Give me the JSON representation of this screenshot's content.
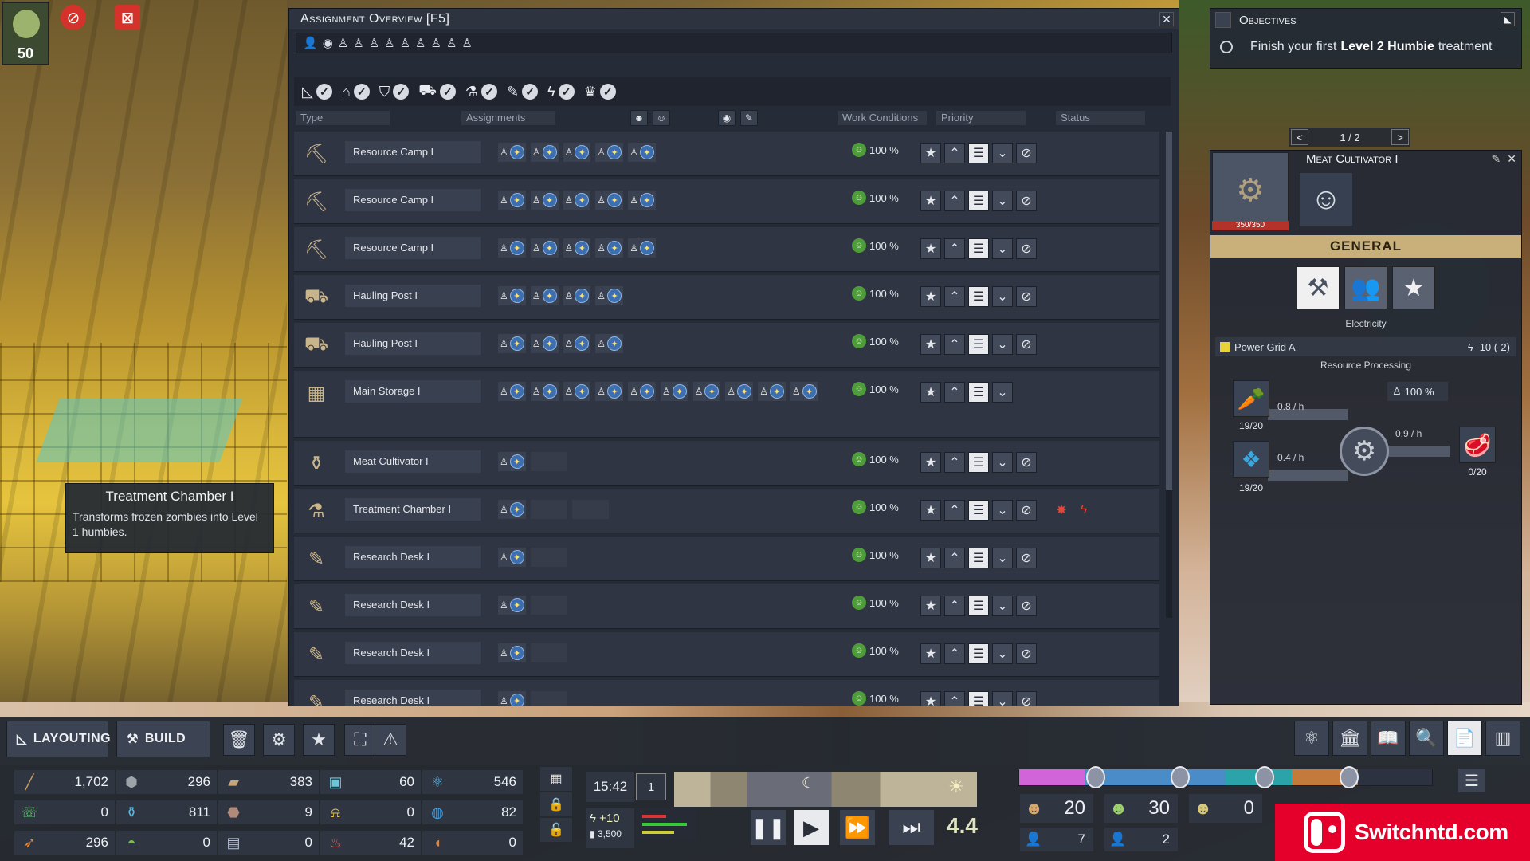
{
  "hud": {
    "population": "50"
  },
  "assignment_overview": {
    "title": "Assignment Overview [F5]",
    "close_label": "✕",
    "headers": {
      "type": "Type",
      "assignments": "Assignments",
      "work_conditions": "Work Conditions",
      "priority": "Priority",
      "status": "Status"
    },
    "rows": [
      {
        "name": "Resource Camp I",
        "icon": "resource-camp-icon",
        "slots": 5,
        "empty": 0,
        "wc": "100 %",
        "cancel": true,
        "status": []
      },
      {
        "name": "Resource Camp I",
        "icon": "resource-camp-icon",
        "slots": 5,
        "empty": 0,
        "wc": "100 %",
        "cancel": true,
        "status": []
      },
      {
        "name": "Resource Camp I",
        "icon": "resource-camp-icon",
        "slots": 5,
        "empty": 0,
        "wc": "100 %",
        "cancel": true,
        "status": []
      },
      {
        "name": "Hauling Post I",
        "icon": "hauling-post-icon",
        "slots": 4,
        "empty": 0,
        "wc": "100 %",
        "cancel": true,
        "status": []
      },
      {
        "name": "Hauling Post I",
        "icon": "hauling-post-icon",
        "slots": 4,
        "empty": 0,
        "wc": "100 %",
        "cancel": true,
        "status": []
      },
      {
        "name": "Main Storage I",
        "icon": "main-storage-icon",
        "slots": 10,
        "empty": 0,
        "wc": "100 %",
        "cancel": false,
        "status": [],
        "tall": true
      },
      {
        "name": "Meat Cultivator I",
        "icon": "meat-cultivator-icon",
        "slots": 1,
        "empty": 1,
        "wc": "100 %",
        "cancel": true,
        "status": []
      },
      {
        "name": "Treatment Chamber I",
        "icon": "treatment-chamber-icon",
        "slots": 1,
        "empty": 2,
        "wc": "100 %",
        "cancel": true,
        "status": [
          "no-resource-icon",
          "no-power-icon"
        ]
      },
      {
        "name": "Research Desk I",
        "icon": "research-desk-icon",
        "slots": 1,
        "empty": 1,
        "wc": "100 %",
        "cancel": true,
        "status": []
      },
      {
        "name": "Research Desk I",
        "icon": "research-desk-icon",
        "slots": 1,
        "empty": 1,
        "wc": "100 %",
        "cancel": true,
        "status": []
      },
      {
        "name": "Research Desk I",
        "icon": "research-desk-icon",
        "slots": 1,
        "empty": 1,
        "wc": "100 %",
        "cancel": true,
        "status": []
      },
      {
        "name": "Research Desk I",
        "icon": "research-desk-icon",
        "slots": 1,
        "empty": 1,
        "wc": "100 %",
        "cancel": true,
        "status": []
      }
    ]
  },
  "tooltip": {
    "title": "Treatment Chamber I",
    "body": "Transforms frozen zombies into Level 1 humbies."
  },
  "objectives": {
    "title": "Objectives",
    "item_pre": "Finish your first",
    "item_bold": "Level 2 Humbie",
    "item_post": "treatment"
  },
  "building_panel": {
    "pager": "1 / 2",
    "name": "Meat Cultivator I",
    "hp": "350/350",
    "tab": "GENERAL",
    "electricity_label": "Electricity",
    "power_grid": "Power Grid A",
    "power_value": "-10 (-2)",
    "processing_label": "Resource Processing",
    "efficiency": "100 %",
    "input1_count": "19/20",
    "input1_rate": "0.8 / h",
    "input2_count": "19/20",
    "input2_rate": "0.4 / h",
    "output_rate": "0.9 / h",
    "output_count": "0/20"
  },
  "bottom": {
    "layouting": "LAYOUTING",
    "build": "BUILD",
    "resources": [
      {
        "icon": "wood-icon",
        "value": "1,702"
      },
      {
        "icon": "stone-icon",
        "value": "296"
      },
      {
        "icon": "plank-icon",
        "value": "383"
      },
      {
        "icon": "canister-icon",
        "value": "60"
      },
      {
        "icon": "research-icon",
        "value": "546"
      },
      {
        "icon": "phone-icon",
        "value": "0"
      },
      {
        "icon": "jar-icon",
        "value": "811"
      },
      {
        "icon": "ore-icon",
        "value": "9"
      },
      {
        "icon": "bell-icon",
        "value": "0"
      },
      {
        "icon": "globe-icon",
        "value": "82"
      },
      {
        "icon": "carrot-icon",
        "value": "296"
      },
      {
        "icon": "food-bowl-icon",
        "value": "0"
      },
      {
        "icon": "book-icon",
        "value": "0"
      },
      {
        "icon": "meat-icon",
        "value": "42"
      },
      {
        "icon": "steak-icon",
        "value": "0"
      }
    ],
    "time": "15:42",
    "day": "1",
    "power_gain": "+10",
    "power_cap": "3,500",
    "speed": "4.4",
    "pop": [
      {
        "value": "20",
        "sub": "7"
      },
      {
        "value": "30",
        "sub": "2"
      },
      {
        "value": "0",
        "sub": ""
      }
    ]
  },
  "watermark": {
    "text": "Switchntd.com"
  }
}
